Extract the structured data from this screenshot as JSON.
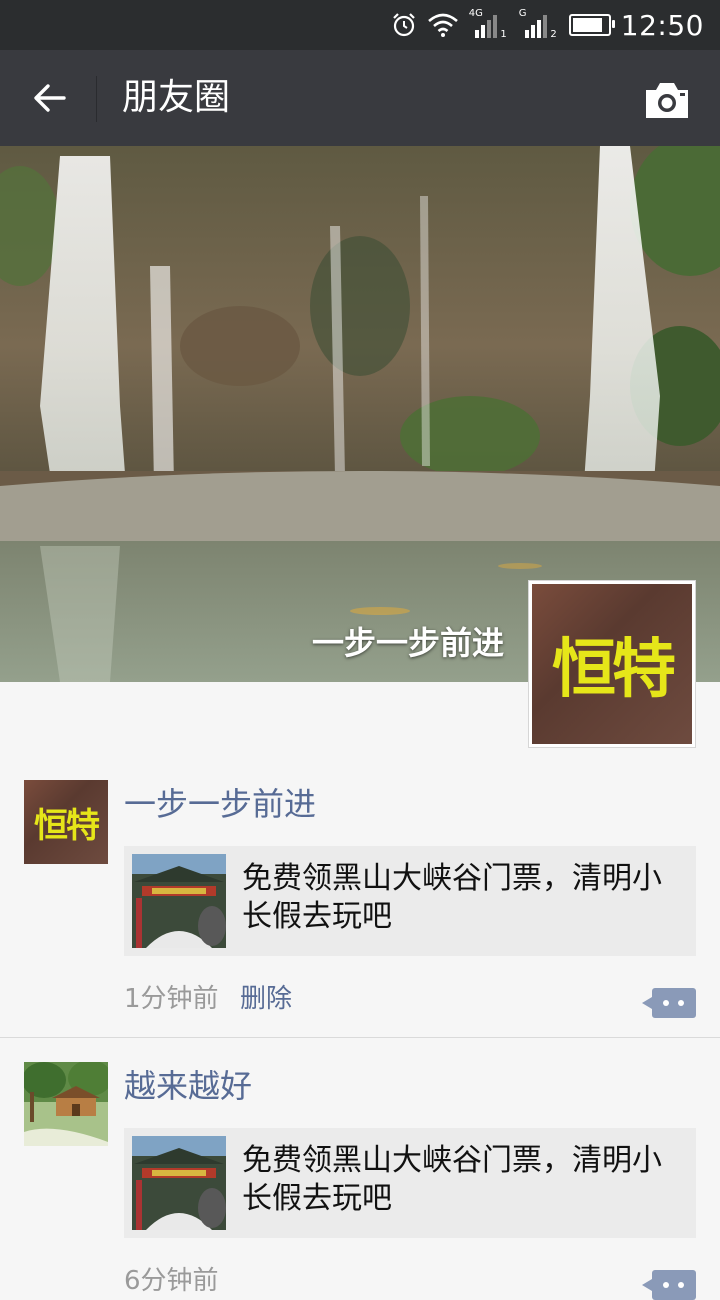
{
  "status_bar": {
    "time": "12:50",
    "sim1_label": "4G",
    "sim1_index": "1",
    "sim2_label": "G",
    "sim2_index": "2",
    "battery_level_fraction": 0.85,
    "icons": [
      "alarm-icon",
      "wifi-icon",
      "signal-icon",
      "signal-icon",
      "battery-icon"
    ]
  },
  "nav": {
    "title": "朋友圈",
    "back_icon": "arrow-left-icon",
    "camera_icon": "camera-icon"
  },
  "cover": {
    "user_name": "一步一步前进",
    "avatar_text": "恒特"
  },
  "posts": [
    {
      "author": "一步一步前进",
      "avatar_text": "恒特",
      "share_text": "免费领黑山大峡谷门票，清明小长假去玩吧",
      "time": "1分钟前",
      "delete_label": "删除"
    },
    {
      "author": "越来越好",
      "share_text": "免费领黑山大峡谷门票，清明小长假去玩吧",
      "time": "6分钟前"
    }
  ],
  "colors": {
    "navbar": "#393a3f",
    "statusbar": "#2b2d2f",
    "link": "#576b95",
    "avatar_text": "#e6e619"
  }
}
